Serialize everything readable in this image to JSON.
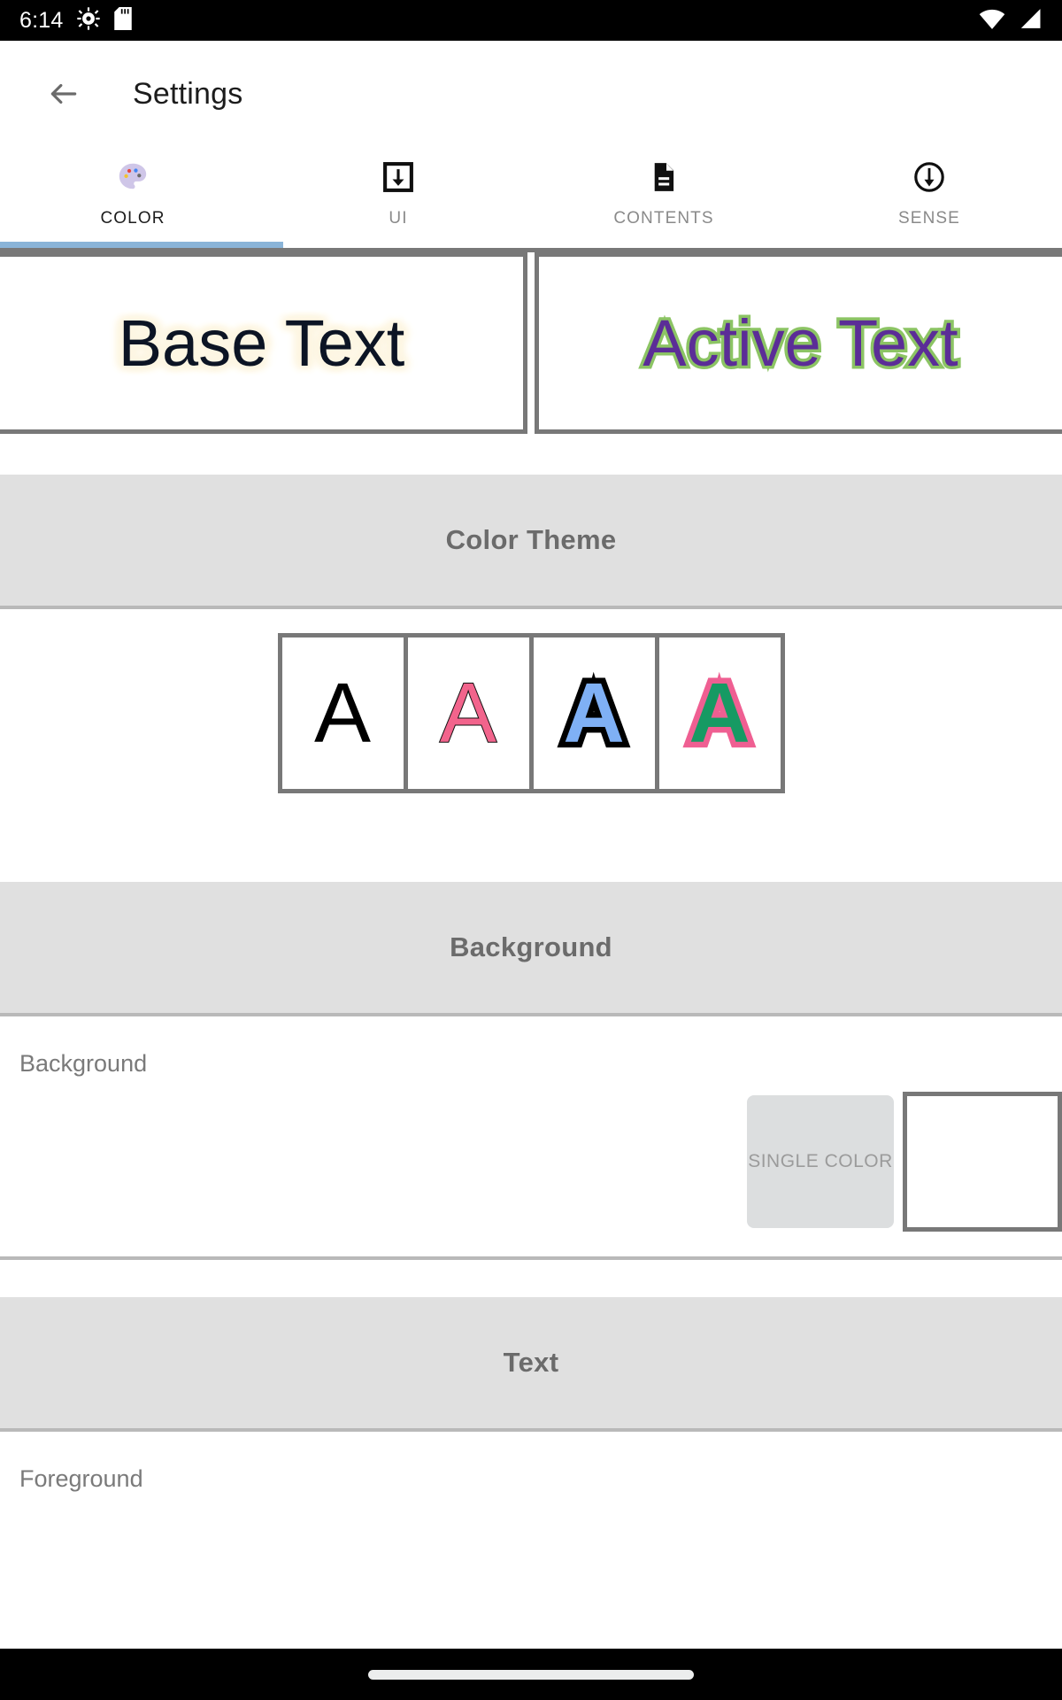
{
  "status_bar": {
    "time": "6:14",
    "left_icons": [
      "gear-icon",
      "sd-card-icon"
    ],
    "right_icons": [
      "wifi-icon",
      "cell-signal-icon"
    ]
  },
  "app_bar": {
    "back_icon": "back-arrow-icon",
    "title": "Settings"
  },
  "tabs": {
    "selected_index": 0,
    "indicator_color": "#8ab4d8",
    "items": [
      {
        "label": "COLOR",
        "icon": "palette-icon"
      },
      {
        "label": "UI",
        "icon": "download-box-icon"
      },
      {
        "label": "CONTENTS",
        "icon": "document-icon"
      },
      {
        "label": "SENSE",
        "icon": "circle-down-arrow-icon"
      }
    ]
  },
  "preview": {
    "base": {
      "text": "Base Text",
      "color": "#0c1424",
      "glow_color": "#fdf6e3"
    },
    "active": {
      "text": "Active Text",
      "color": "#5b2d97",
      "outline_color": "#8cc464"
    }
  },
  "sections": {
    "color_theme": {
      "title": "Color Theme",
      "swatches": [
        {
          "glyph": "A",
          "name": "theme-plain-black",
          "fill": "#000000",
          "outline": "none"
        },
        {
          "glyph": "A",
          "name": "theme-pink-outline",
          "fill": "#f2648c",
          "outline": "#111111"
        },
        {
          "glyph": "A",
          "name": "theme-blue-black",
          "fill": "#7fb0f5",
          "outline": "#000000"
        },
        {
          "glyph": "A",
          "name": "theme-green-pink",
          "fill": "#169a63",
          "outline": "#ef5f92"
        }
      ]
    },
    "background": {
      "title": "Background",
      "row_label": "Background",
      "mode_button": "SINGLE COLOR",
      "swatch_color": "#ffffff"
    },
    "text": {
      "title": "Text",
      "row_label": "Foreground"
    }
  },
  "nav_bar": {
    "home_indicator": "home-gesture-pill"
  }
}
